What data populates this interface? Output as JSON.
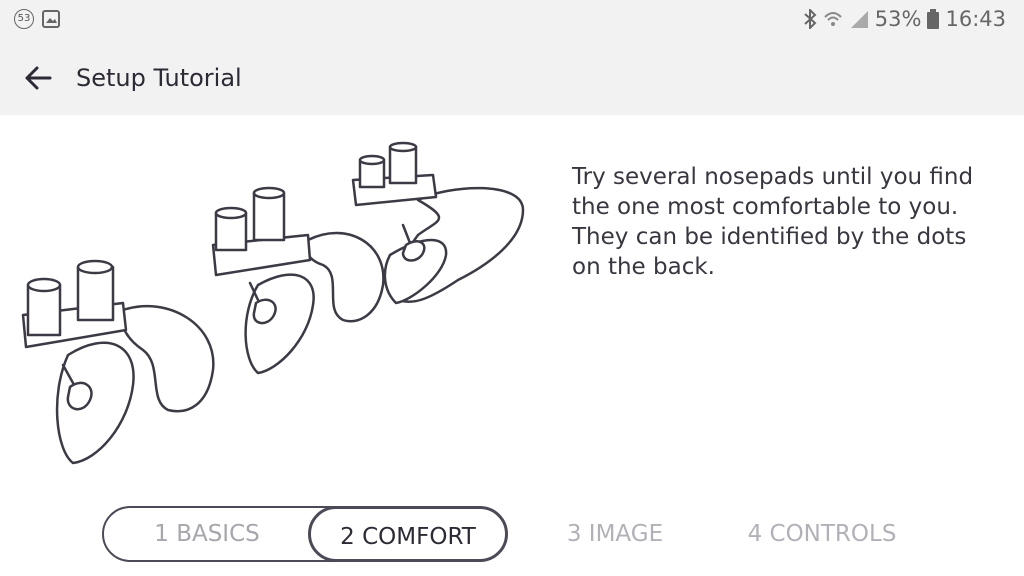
{
  "status_bar": {
    "notification_count": "53",
    "battery_percent": "53%",
    "time": "16:43",
    "icons": [
      "notification-count-icon",
      "gallery-icon",
      "bluetooth-icon",
      "wifi-icon",
      "signal-icon",
      "battery-icon"
    ]
  },
  "app_bar": {
    "title": "Setup Tutorial",
    "back_icon": "arrow-left-icon"
  },
  "content": {
    "description": "Try several nosepads until you find the one most comfortable to you. They can be identified by the dots on the back.",
    "illustration_icon": "nosepads-illustration"
  },
  "steps": [
    {
      "label": "1 BASICS",
      "state": "done"
    },
    {
      "label": "2 COMFORT",
      "state": "active"
    },
    {
      "label": "3 IMAGE",
      "state": "upcoming"
    },
    {
      "label": "4 CONTROLS",
      "state": "upcoming"
    }
  ],
  "colors": {
    "bar_background": "#f2f2f2",
    "text_primary": "#2e2a35",
    "outline": "#4d4956",
    "inactive": "#b3b1b8"
  }
}
